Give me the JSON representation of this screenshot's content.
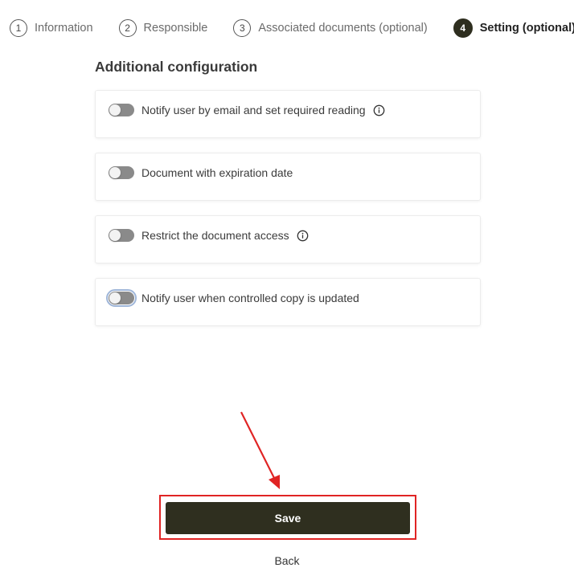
{
  "stepper": {
    "steps": [
      {
        "number": "1",
        "label": "Information",
        "active": false
      },
      {
        "number": "2",
        "label": "Responsible",
        "active": false
      },
      {
        "number": "3",
        "label": "Associated documents (optional)",
        "active": false
      },
      {
        "number": "4",
        "label": "Setting (optional)",
        "active": true
      }
    ]
  },
  "section": {
    "title": "Additional configuration"
  },
  "options": [
    {
      "label": "Notify user by email and set required reading",
      "enabled": false,
      "has_info_icon": true
    },
    {
      "label": "Document with expiration date",
      "enabled": false,
      "has_info_icon": false
    },
    {
      "label": "Restrict the document access",
      "enabled": false,
      "has_info_icon": true
    },
    {
      "label": "Notify user when controlled copy is updated",
      "enabled": false,
      "has_info_icon": false,
      "focused": true
    }
  ],
  "actions": {
    "save_label": "Save",
    "back_label": "Back"
  },
  "colors": {
    "primary_button": "#2f2f1f",
    "annotation": "#e02424",
    "toggle_off": "#8a8a8a"
  },
  "icons": {
    "info": "info-circle-icon",
    "annotation_arrow": "arrow-down-icon"
  }
}
